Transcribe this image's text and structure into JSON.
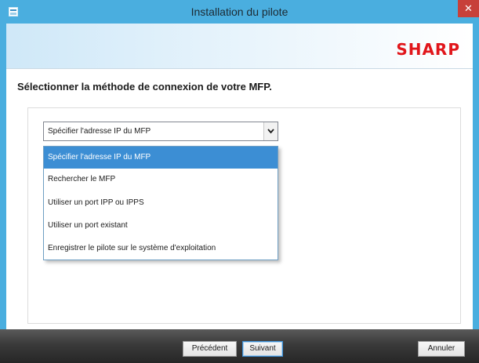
{
  "window": {
    "title": "Installation du pilote",
    "close_glyph": "✕",
    "app_icon": "installer-window-icon"
  },
  "header": {
    "brand_logo": "SHARP",
    "brand_color": "#e1161b"
  },
  "main": {
    "instruction": "Sélectionner la méthode de connexion de votre MFP.",
    "combo": {
      "selected_value": "Spécifier l'adresse IP du MFP",
      "arrow_icon": "chevron-down-icon",
      "options": [
        "Spécifier l'adresse IP du MFP",
        "Rechercher le MFP",
        "Utiliser un port IPP ou IPPS",
        "Utiliser un port existant",
        "Enregistrer le pilote sur le système d'exploitation"
      ],
      "highlighted_index": 0
    }
  },
  "footer": {
    "back_label": "Précédent",
    "next_label": "Suivant",
    "cancel_label": "Annuler"
  },
  "colors": {
    "window_frame": "#4aaedf",
    "selection": "#3c8ed4",
    "close_button": "#c7403a"
  }
}
